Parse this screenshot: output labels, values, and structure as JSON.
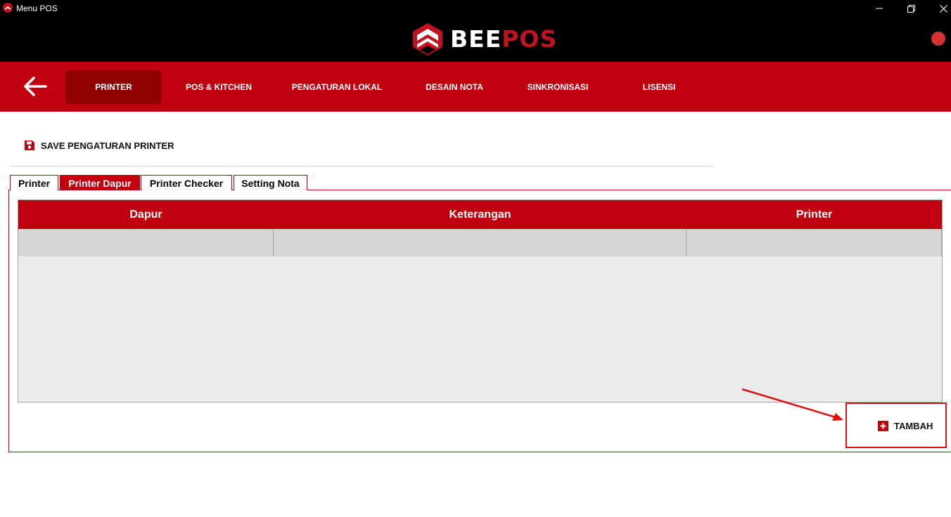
{
  "window": {
    "title": "Menu POS",
    "controls": [
      "minimize",
      "restore",
      "close"
    ]
  },
  "brand": {
    "name_white": "BEE",
    "name_red": "POS",
    "status_color": "#d63232"
  },
  "nav": {
    "back_icon": "arrow-left-icon",
    "items": [
      {
        "label": "PRINTER",
        "active": true
      },
      {
        "label": "POS & KITCHEN",
        "active": false
      },
      {
        "label": "PENGATURAN LOKAL",
        "active": false
      },
      {
        "label": "DESAIN NOTA",
        "active": false
      },
      {
        "label": "SINKRONISASI",
        "active": false
      },
      {
        "label": "LISENSI",
        "active": false
      }
    ]
  },
  "save": {
    "icon": "floppy-disk-icon",
    "label": "SAVE PENGATURAN PRINTER"
  },
  "tabs": [
    {
      "label": "Printer",
      "active": false
    },
    {
      "label": "Printer Dapur",
      "active": true
    },
    {
      "label": "Printer Checker",
      "active": false
    },
    {
      "label": "Setting Nota",
      "active": false
    }
  ],
  "table": {
    "columns": [
      "Dapur",
      "Keterangan",
      "Printer"
    ],
    "rows": [
      [
        "",
        "",
        ""
      ]
    ]
  },
  "tambah": {
    "icon": "plus-square-icon",
    "label": "TAMBAH"
  },
  "colors": {
    "primary_red": "#c1000f",
    "active_nav": "#8f0000",
    "highlight_red": "#e01010"
  }
}
